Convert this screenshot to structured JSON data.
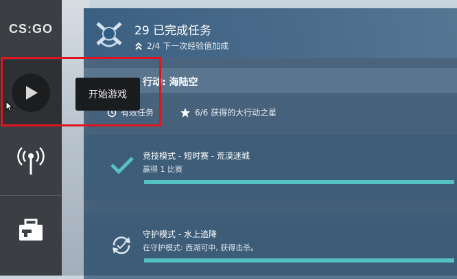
{
  "app": {
    "logo_text": "CS:GO"
  },
  "sidebar": {
    "items": [
      {
        "name": "play",
        "icon": "play-icon",
        "tooltip": "开始游戏"
      },
      {
        "name": "broadcast",
        "icon": "broadcast-icon"
      },
      {
        "name": "inventory",
        "icon": "briefcase-icon"
      }
    ]
  },
  "header": {
    "completed_text": "29 已完成任务",
    "xp_text": "2/4 下一次经验值加成"
  },
  "operation": {
    "title": "行动: 海陆空",
    "active_missions_label": "有效任务",
    "stars_text": "6/6 获得的大行动之星"
  },
  "missions": [
    {
      "title": "竞技模式 - 短时赛 - 荒漠迷城",
      "desc": "赢得 1 比赛",
      "icon": "check-icon",
      "progress": 1.0
    },
    {
      "title": "守护模式 - 水上追降",
      "desc": "在守护模式: 西湖可中, 获得击杀。",
      "icon": "refresh-icon",
      "progress": 1.0
    }
  ],
  "colors": {
    "highlight": "#e0141f",
    "progress": "#55c1c6",
    "sidebar": "#3b3e42"
  }
}
